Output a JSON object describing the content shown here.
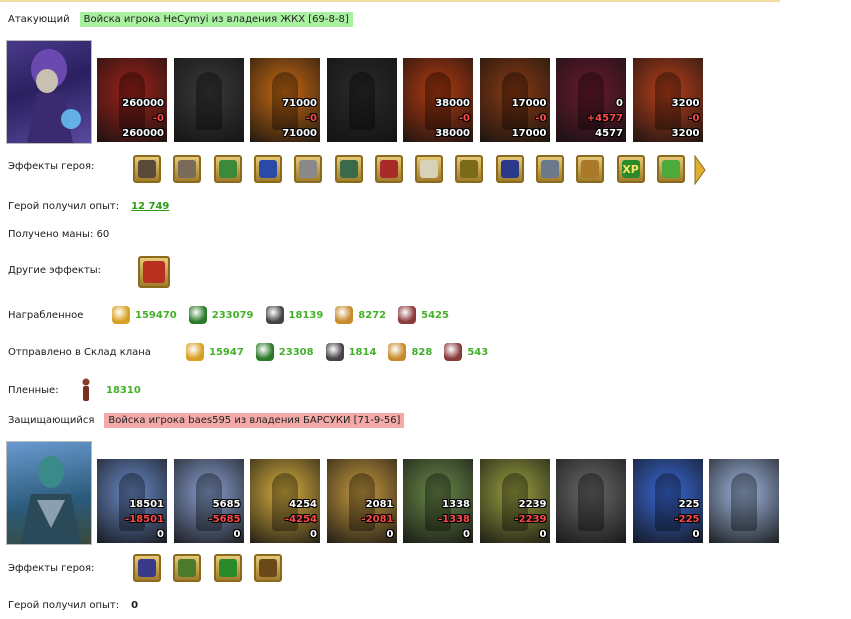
{
  "attacker": {
    "label": "Атакующий",
    "banner": "Войска игрока НеCymyi из владения ЖКХ [69-8-8]",
    "units": [
      {
        "icon": "red-dragon-unit",
        "c1": "260000",
        "c2": "-0",
        "c3": "260000",
        "color": "#a0221a"
      },
      {
        "icon": "skeleton-unit",
        "c1": "",
        "c2": "",
        "c3": "",
        "color": "#3a3a3a"
      },
      {
        "icon": "fire-elemental-unit",
        "c1": "71000",
        "c2": "-0",
        "c3": "71000",
        "color": "#c86a12"
      },
      {
        "icon": "gargoyle-unit",
        "c1": "",
        "c2": "",
        "c3": "",
        "color": "#2a2a2a"
      },
      {
        "icon": "magma-golem-unit",
        "c1": "38000",
        "c2": "-0",
        "c3": "38000",
        "color": "#b23a10"
      },
      {
        "icon": "fire-warrior-unit",
        "c1": "17000",
        "c2": "-0",
        "c3": "17000",
        "color": "#8a3a12"
      },
      {
        "icon": "demon-lord-unit",
        "c1": "0",
        "c2": "+4577",
        "c3": "4577",
        "color": "#6a1a30"
      },
      {
        "icon": "fire-mage-unit",
        "c1": "3200",
        "c2": "-0",
        "c3": "3200",
        "color": "#b8401a"
      }
    ],
    "effects_label": "Эффекты героя:",
    "effects": [
      {
        "icon": "skull-mask-icon",
        "color": "#5a4a3a"
      },
      {
        "icon": "half-face-icon",
        "color": "#7a6a5a"
      },
      {
        "icon": "green-scroll-icon",
        "color": "#3a8a3a"
      },
      {
        "icon": "blue-star-icon",
        "color": "#2a4aaa"
      },
      {
        "icon": "silver-web-icon",
        "color": "#8a8a8a"
      },
      {
        "icon": "column-icon",
        "color": "#3a6a4a"
      },
      {
        "icon": "red-swords-icon",
        "color": "#aa2a2a"
      },
      {
        "icon": "parchment-icon",
        "color": "#d8d0b8"
      },
      {
        "icon": "golden-sword-icon",
        "color": "#7a6a1a"
      },
      {
        "icon": "horned-helm-icon",
        "color": "#2a3a8a"
      },
      {
        "icon": "half-face-blue-icon",
        "color": "#6a7a8a"
      },
      {
        "icon": "coiled-serpent-icon",
        "color": "#aa7a2a"
      },
      {
        "icon": "xp-icon",
        "label": "XP",
        "color": "#2a8a2a"
      },
      {
        "icon": "green-potion-icon",
        "color": "#4aaa3a"
      }
    ],
    "xp_label": "Герой получил опыт:",
    "xp_value": "12 749",
    "mana_label": "Получено маны: 60",
    "other_label": "Другие эффекты:",
    "loot_label": "Награбленное",
    "loot": [
      {
        "icon": "gold-icon",
        "value": "159470",
        "color": "#d8a020"
      },
      {
        "icon": "wood-icon",
        "value": "233079",
        "color": "#2a7a2a"
      },
      {
        "icon": "ore-icon",
        "value": "18139",
        "color": "#444444"
      },
      {
        "icon": "crystal-icon",
        "value": "8272",
        "color": "#c88a2a"
      },
      {
        "icon": "mercury-icon",
        "value": "5425",
        "color": "#8a3a3a"
      }
    ],
    "sent_label": "Отправлено в Склад клана",
    "sent": [
      {
        "icon": "gold-icon",
        "value": "15947",
        "color": "#d8a020"
      },
      {
        "icon": "wood-icon",
        "value": "23308",
        "color": "#2a7a2a"
      },
      {
        "icon": "ore-icon",
        "value": "1814",
        "color": "#444444"
      },
      {
        "icon": "crystal-icon",
        "value": "828",
        "color": "#c88a2a"
      },
      {
        "icon": "mercury-icon",
        "value": "543",
        "color": "#8a3a3a"
      }
    ],
    "captives_label": "Пленные:",
    "captives_value": "18310"
  },
  "defender": {
    "label": "Защищающийся",
    "banner": "Войска игрока baes595 из владения БАРСУКИ [71-9-56]",
    "units": [
      {
        "icon": "pikeman-unit",
        "c1": "18501",
        "c2": "-18501",
        "c3": "0",
        "color": "#6a8ac8"
      },
      {
        "icon": "archer-unit",
        "c1": "5685",
        "c2": "-5685",
        "c3": "0",
        "color": "#8aa0d0"
      },
      {
        "icon": "knight-unit",
        "c1": "4254",
        "c2": "-4254",
        "c3": "0",
        "color": "#d8b040"
      },
      {
        "icon": "griffin-unit",
        "c1": "2081",
        "c2": "-2081",
        "c3": "0",
        "color": "#c89a40"
      },
      {
        "icon": "crossbowman-unit",
        "c1": "1338",
        "c2": "-1338",
        "c3": "0",
        "color": "#6a8a4a"
      },
      {
        "icon": "monk-unit",
        "c1": "2239",
        "c2": "-2239",
        "c3": "0",
        "color": "#9aa040"
      },
      {
        "icon": "dark-warrior-unit",
        "c1": "",
        "c2": "",
        "c3": "",
        "color": "#6a6a6a"
      },
      {
        "icon": "wizard-unit",
        "c1": "225",
        "c2": "-225",
        "c3": "0",
        "color": "#3a6ad8"
      },
      {
        "icon": "tower-unit",
        "c1": "",
        "c2": "",
        "c3": "",
        "color": "#a0b8e0"
      }
    ],
    "effects_label": "Эффекты героя:",
    "effects": [
      {
        "icon": "castle-crest-icon",
        "color": "#3a3a8a"
      },
      {
        "icon": "wreath-icon",
        "color": "#4a7a2a"
      },
      {
        "icon": "clover-icon",
        "color": "#2a8a2a"
      },
      {
        "icon": "bow-icon",
        "color": "#6a4a1a"
      }
    ],
    "xp_label": "Герой получил опыт:",
    "xp_value": "0"
  }
}
